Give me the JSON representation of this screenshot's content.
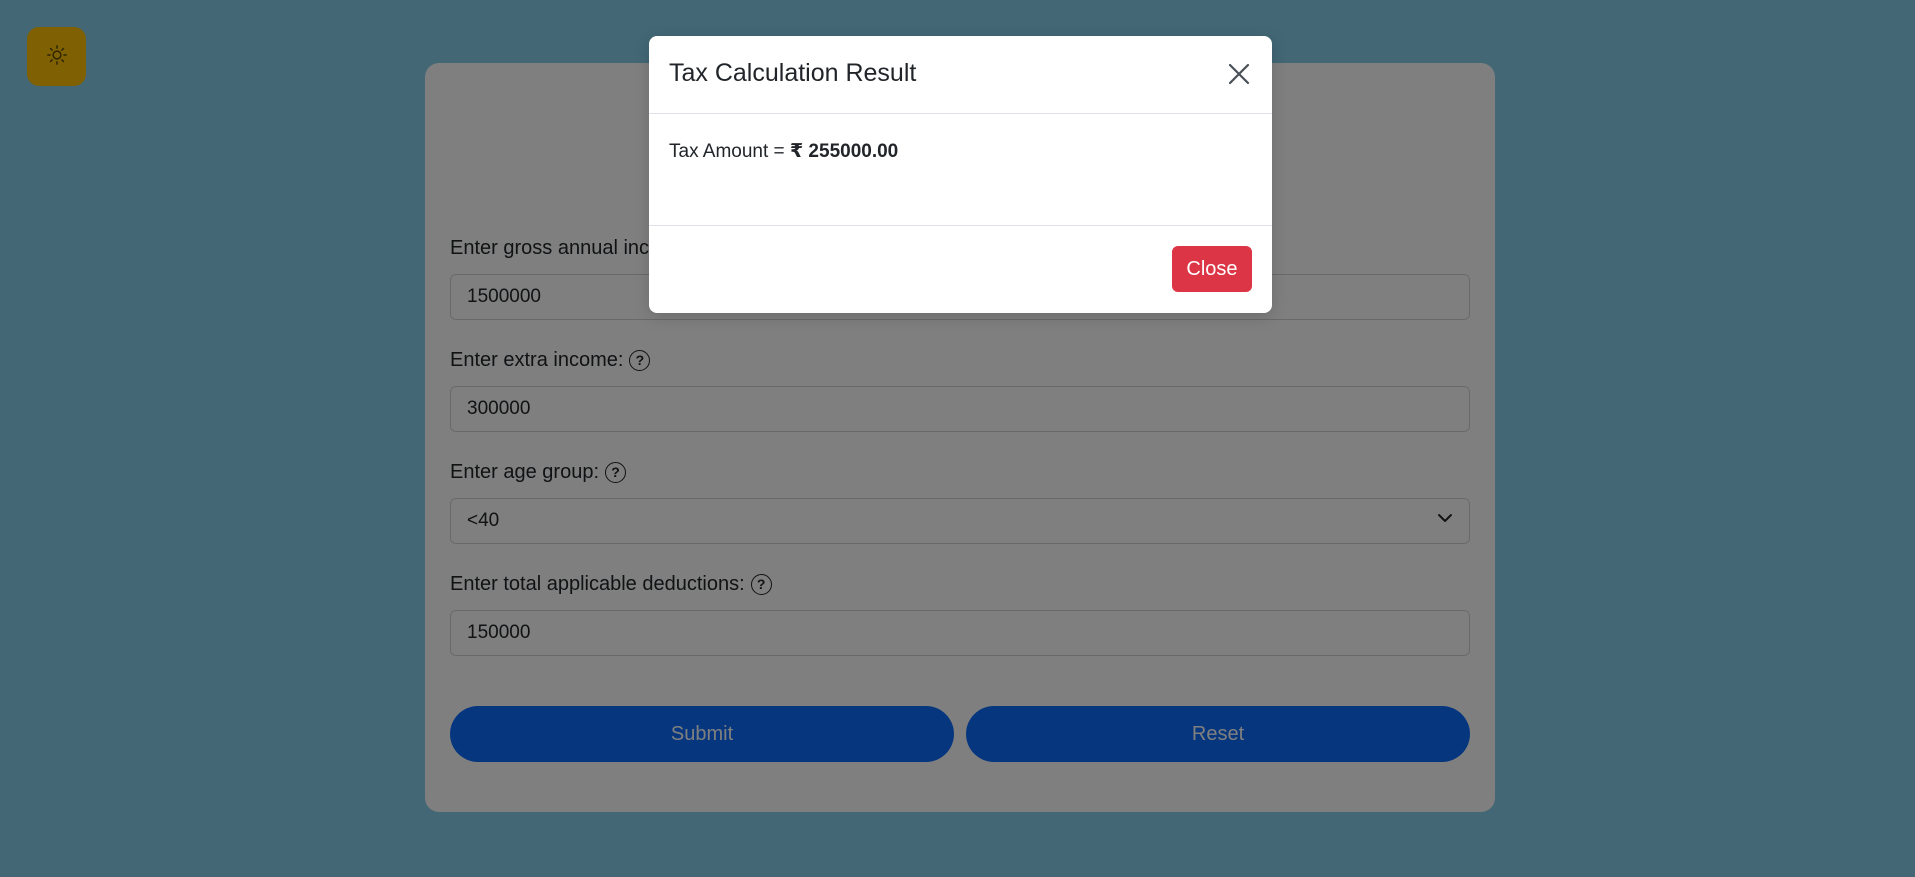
{
  "theme_toggle": {
    "icon": "sun-icon"
  },
  "form": {
    "gross_income": {
      "label": "Enter gross annual inco",
      "value": "1500000"
    },
    "extra_income": {
      "label": "Enter extra income:",
      "value": "300000"
    },
    "age_group": {
      "label": "Enter age group:",
      "value": "<40"
    },
    "deductions": {
      "label": "Enter total applicable deductions:",
      "value": "150000"
    },
    "submit_label": "Submit",
    "reset_label": "Reset",
    "help_glyph": "?"
  },
  "modal": {
    "title": "Tax Calculation Result",
    "body_prefix": "Tax Amount =",
    "tax_amount": "₹ 255000.00",
    "close_label": "Close"
  },
  "colors": {
    "theme_toggle": "#ffc107",
    "primary": "#0d6efd",
    "danger": "#dc3545",
    "backdrop": "rgba(0,0,0,0.5)"
  }
}
